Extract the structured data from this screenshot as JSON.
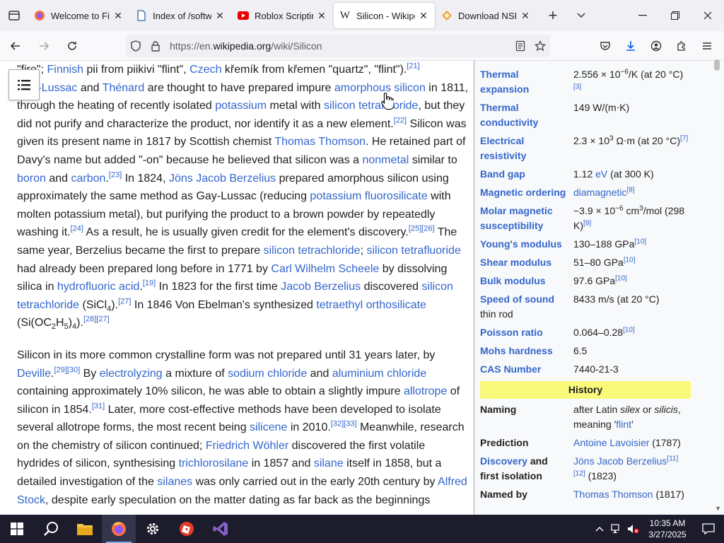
{
  "browser": {
    "tabs": [
      {
        "label": "Welcome to Firefox",
        "icon": "firefox-icon",
        "active": false
      },
      {
        "label": "Index of /software",
        "icon": "document-icon",
        "active": false
      },
      {
        "label": "Roblox Scripting",
        "icon": "youtube-icon",
        "active": false
      },
      {
        "label": "Silicon - Wikipedia",
        "icon": "wikipedia-icon",
        "active": true
      },
      {
        "label": "Download NSIS",
        "icon": "nsis-icon",
        "active": false
      }
    ],
    "url_prefix": "https://en.",
    "url_domain": "wikipedia.org",
    "url_path": "/wiki/Silicon"
  },
  "article": {
    "p1": {
      "t1": "\"fire\"; ",
      "a1": "Finnish",
      "t2": " pii from piikivi \"flint\", ",
      "a2": "Czech",
      "t3": " křemík from křemen \"quartz\", \"flint\").",
      "r1": "[21]",
      "t4": "",
      "a3": "Gay-Lussac",
      "t5": " and ",
      "a4": "Thénard",
      "t6": " are thought to have prepared impure ",
      "a5": "amorphous silicon",
      "t7": " in 1811, through the heating of recently isolated ",
      "a6": "potassium",
      "t8": " metal with ",
      "a7": "silicon tetrafluoride",
      "t9": ", but they did not purify and characterize the product, nor identify it as a new element.",
      "r2": "[22]",
      "t10": " Silicon was given its present name in 1817 by Scottish chemist ",
      "a8": "Thomas Thomson",
      "t11": ". He retained part of Davy's name but added \"-on\" because he believed that silicon was a ",
      "a9": "nonmetal",
      "t12": " similar to ",
      "a10": "boron",
      "t13": " and ",
      "a11": "carbon",
      "t14": ".",
      "r3": "[23]",
      "t15": " In 1824, ",
      "a12": "Jöns Jacob Berzelius",
      "t16": " prepared amorphous silicon using approximately the same method as Gay-Lussac (reducing ",
      "a13": "potassium fluorosilicate",
      "t17": " with molten potassium metal), but purifying the product to a brown powder by repeatedly washing it.",
      "r4": "[24]",
      "t18": " As a result, he is usually given credit for the element's discovery.",
      "r5": "[25]",
      "r6": "[26]",
      "t19": " The same year, Berzelius became the first to prepare ",
      "a14": "silicon tetrachloride",
      "t20": "; ",
      "a15": "silicon tetrafluoride",
      "t21": " had already been prepared long before in 1771 by ",
      "a16": "Carl Wilhelm Scheele",
      "t22": " by dissolving silica in ",
      "a17": "hydrofluoric acid",
      "t23": ".",
      "r7": "[19]",
      "t24": " In 1823 for the first time ",
      "a18": "Jacob Berzelius",
      "t25": " discovered ",
      "a19": "silicon tetrachloride",
      "t26": " (SiCl",
      "s1": "4",
      "t27": ").",
      "r8": "[27]",
      "t28": " In 1846 Von Ebelman's synthesized ",
      "a20": "tetraethyl orthosilicate",
      "t29": " (Si(OC",
      "s2": "2",
      "t30": "H",
      "s3": "5",
      "t31": ")",
      "s4": "4",
      "t32": ").",
      "r9": "[28]",
      "r10": "[27]"
    },
    "p2": {
      "t1": "Silicon in its more common crystalline form was not prepared until 31 years later, by ",
      "a1": "Deville",
      "t2": ".",
      "r1": "[29]",
      "r2": "[30]",
      "t3": " By ",
      "a2": "electrolyzing",
      "t4": " a mixture of ",
      "a3": "sodium chloride",
      "t5": " and ",
      "a4": "aluminium chloride",
      "t6": " containing approximately 10% silicon, he was able to obtain a slightly impure ",
      "a5": "allotrope",
      "t7": " of silicon in 1854.",
      "r3": "[31]",
      "t8": " Later, more cost-effective methods have been developed to isolate several allotrope forms, the most recent being ",
      "a6": "silicene",
      "t9": " in 2010.",
      "r4": "[32]",
      "r5": "[33]",
      "t10": " Meanwhile, research on the chemistry of silicon continued; ",
      "a7": "Friedrich Wöhler",
      "t11": " discovered the first volatile hydrides of silicon, synthesising ",
      "a8": "trichlorosilane",
      "t12": " in 1857 and ",
      "a9": "silane",
      "t13": " itself in 1858, but a detailed investigation of the ",
      "a10": "silanes",
      "t14": " was only carried out in the early 20th century by ",
      "a11": "Alfred Stock",
      "t15": ", despite early speculation on the matter dating as far back as the beginnings"
    }
  },
  "infobox": {
    "thermal_expansion": {
      "label": "Thermal expansion",
      "value": "2.556 × 10",
      "exp": "−6",
      "unit": "/K (at 20 °C)",
      "ref": "[3]"
    },
    "thermal_conductivity": {
      "label": "Thermal conductivity",
      "value": "149 W/(m⋅K)"
    },
    "electrical_resistivity": {
      "label": "Electrical resistivity",
      "value": "2.3 × 10",
      "exp": "3",
      "unit": " Ω⋅m (at 20 °C)",
      "ref": "[7]"
    },
    "band_gap": {
      "label": "Band gap",
      "value1": "1.12 ",
      "link": "eV",
      "value2": " (at 300 K)"
    },
    "magnetic_ordering": {
      "label": "Magnetic ordering",
      "link": "diamagnetic",
      "ref": "[8]"
    },
    "molar_susceptibility": {
      "label": "Molar magnetic susceptibility",
      "value": "−3.9 × 10",
      "exp": "−6",
      "unit": " cm",
      "unit_exp": "3",
      "unit2": "/mol (298 K)",
      "ref": "[9]"
    },
    "youngs_modulus": {
      "label": "Young's modulus",
      "value": "130–188 GPa",
      "ref": "[10]"
    },
    "shear_modulus": {
      "label": "Shear modulus",
      "value": "51–80 GPa",
      "ref": "[10]"
    },
    "bulk_modulus": {
      "label": "Bulk modulus",
      "value": "97.6 GPa",
      "ref": "[10]"
    },
    "speed_of_sound": {
      "label": "Speed of sound",
      "label2": "thin rod",
      "value": "8433 m/s (at 20 °C)"
    },
    "poisson_ratio": {
      "label": "Poisson ratio",
      "value": "0.064–0.28",
      "ref": "[10]"
    },
    "mohs_hardness": {
      "label": "Mohs hardness",
      "value": "6.5"
    },
    "cas_number": {
      "label": "CAS Number",
      "value": "7440-21-3"
    },
    "history_header": "History",
    "naming": {
      "label": "Naming",
      "value1": "after Latin ",
      "em1": "silex",
      "value2": " or ",
      "em2": "silicis",
      "value3": ", meaning '",
      "link": "flint",
      "value4": "'"
    },
    "prediction": {
      "label": "Prediction",
      "link": "Antoine Lavoisier",
      "value": " (1787)"
    },
    "discovery": {
      "label_link": "Discovery",
      "label_rest": " and first isolation",
      "link": "Jöns Jacob Berzelius",
      "ref1": "[11]",
      "ref2": "[12]",
      "value": " (1823)"
    },
    "named_by": {
      "label": "Named by",
      "link": "Thomas Thomson",
      "value": " (1817)"
    }
  },
  "taskbar": {
    "time": "10:35 AM",
    "date": "3/27/2025",
    "apps": [
      "start-icon",
      "search-icon",
      "file-explorer-icon",
      "firefox-icon",
      "settings-icon",
      "roblox-studio-icon",
      "visual-studio-icon"
    ]
  },
  "colors": {
    "link": "#3366cc",
    "history_header": "#f9f97a",
    "taskbar": "#1c1c2c"
  }
}
